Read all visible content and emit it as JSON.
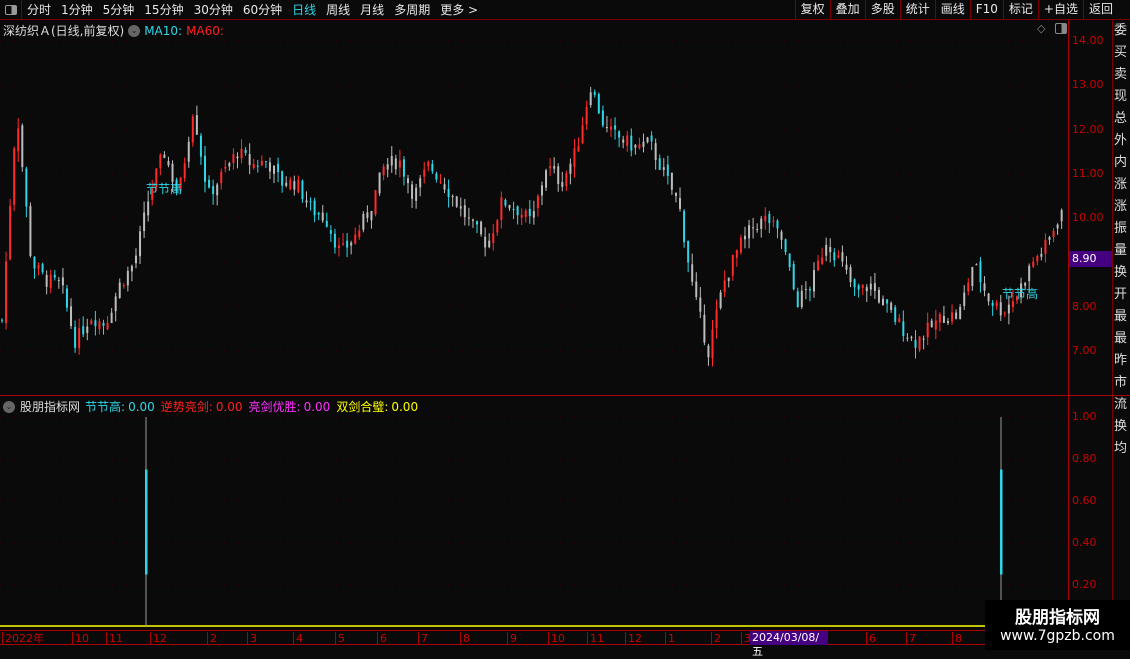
{
  "topbar": {
    "periods": [
      "分时",
      "1分钟",
      "5分钟",
      "15分钟",
      "30分钟",
      "60分钟",
      "日线",
      "周线",
      "月线",
      "多周期",
      "更多 >"
    ],
    "active": "日线",
    "buttons": [
      "复权",
      "叠加",
      "多股",
      "统计",
      "画线",
      "F10",
      "标记",
      "+自选",
      "返回"
    ]
  },
  "main": {
    "stock": "深纺织Ａ(日线,前复权)",
    "ma10": "MA10:",
    "ma60": "MA60:",
    "annotation": "节节高",
    "current_price": "8.90",
    "y_ticks": [
      "14.00",
      "13.00",
      "12.00",
      "11.00",
      "10.00",
      "8.00",
      "7.00"
    ]
  },
  "indicator": {
    "name": "股朋指标网",
    "items": [
      {
        "label": "节节高:",
        "value": "0.00",
        "color": "#2fd6e6"
      },
      {
        "label": "逆势亮剑:",
        "value": "0.00",
        "color": "#ff2020"
      },
      {
        "label": "亮剑优胜:",
        "value": "0.00",
        "color": "#ff30ff"
      },
      {
        "label": "双剑合璧:",
        "value": "0.00",
        "color": "#ffff00"
      }
    ],
    "y_ticks": [
      "1.00",
      "0.80",
      "0.60",
      "0.40",
      "0.20"
    ]
  },
  "date_axis": {
    "labels": [
      "2022年",
      "10",
      "11",
      "12",
      "2",
      "3",
      "4",
      "5",
      "6",
      "7",
      "8",
      "9",
      "10",
      "11",
      "12",
      "1",
      "2",
      "3",
      "6",
      "7",
      "8"
    ],
    "highlight": "2024/03/08/五"
  },
  "watermark": {
    "title": "股朋指标网",
    "url": "www.7gpzb.com"
  },
  "right_panel": {
    "chars": "委买卖现总外内涨涨振量换开最最昨市流换均"
  },
  "colors": {
    "up": "#ff2a2a",
    "down": "#2fd6e6",
    "neutral": "#bdbdbd",
    "axis": "#cc0000",
    "highlight": "#440080"
  },
  "chart_data": {
    "type": "candlestick",
    "price_range": [
      6.7,
      14.0
    ],
    "close_path": [
      7.7,
      12.5,
      9.0,
      8.6,
      8.5,
      7.2,
      7.8,
      7.6,
      8.5,
      9.0,
      10.5,
      11.5,
      10.5,
      12.5,
      10.5,
      11.0,
      11.5,
      11.2,
      11.3,
      10.8,
      10.8,
      10.2,
      10.0,
      9.2,
      9.6,
      10.2,
      11.2,
      11.3,
      10.5,
      11.2,
      10.8,
      10.3,
      9.8,
      9.4,
      10.4,
      10.2,
      9.9,
      11.2,
      10.8,
      11.5,
      13.0,
      12.0,
      11.8,
      11.6,
      11.7,
      11.0,
      10.3,
      8.3,
      7.0,
      8.5,
      9.3,
      9.8,
      10.0,
      9.5,
      8.1,
      8.5,
      9.5,
      9.0,
      8.3,
      8.5,
      8.0,
      7.6,
      7.2,
      7.5,
      7.8,
      7.8,
      9.0,
      8.2,
      7.9,
      8.3,
      9.0,
      9.4,
      10.2
    ],
    "indicator_signals": [
      {
        "date_near": "2022/12",
        "value": 1.0
      },
      {
        "date_near": "2024/08",
        "value": 1.0
      }
    ]
  }
}
